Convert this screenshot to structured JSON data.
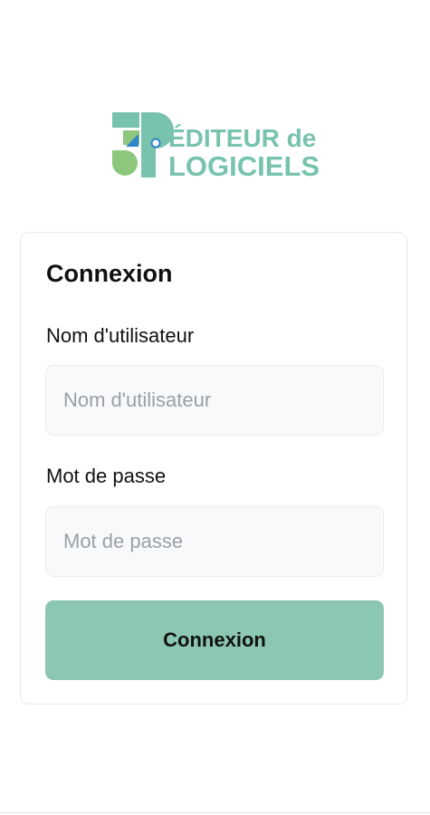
{
  "brand": {
    "line1": "ÉDITEUR de",
    "line2": "LOGICIELS",
    "colors": {
      "green": "#8cc77d",
      "teal": "#78c3ae",
      "blue": "#2f86c8"
    }
  },
  "login": {
    "title": "Connexion",
    "username_label": "Nom d'utilisateur",
    "username_placeholder": "Nom d'utilisateur",
    "username_value": "",
    "password_label": "Mot de passe",
    "password_placeholder": "Mot de passe",
    "password_value": "",
    "submit_label": "Connexion",
    "accent_color": "#8bc7b1"
  }
}
